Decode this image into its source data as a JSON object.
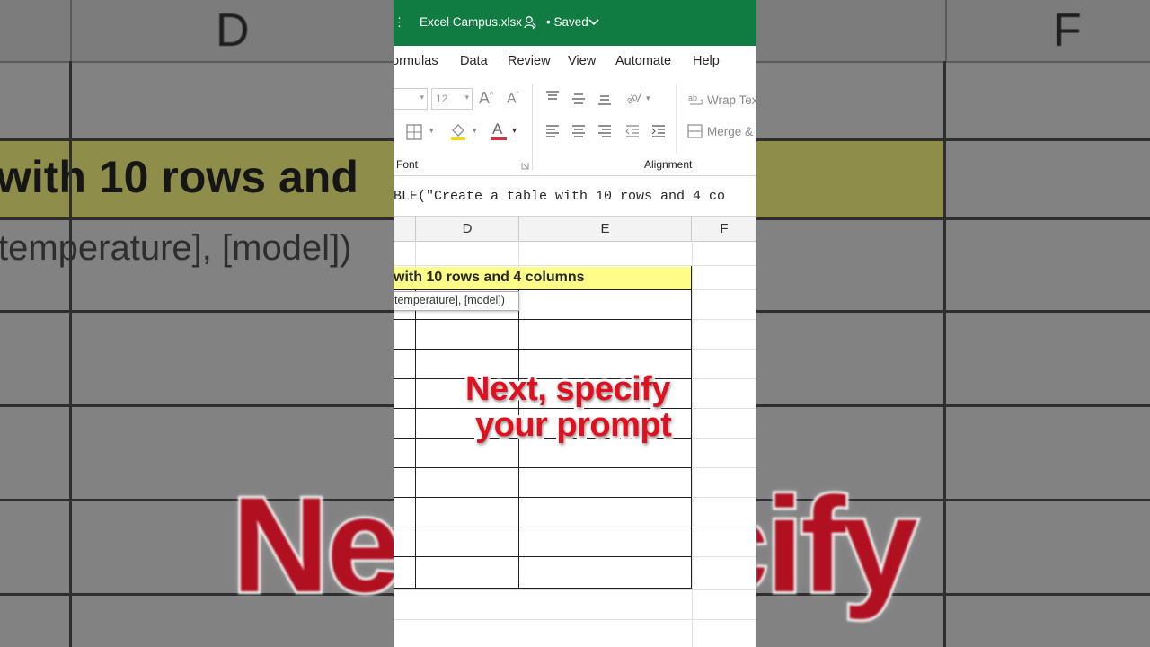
{
  "background": {
    "col_letters": [
      "D",
      "F"
    ],
    "heading_fragment": "with 10 rows and",
    "formula_fragment": "temperature], [model])",
    "caption_fragment_left": "Nex",
    "caption_fragment_right": "cify"
  },
  "titlebar": {
    "filename": "Excel Campus.xlsx",
    "save_status": "• Saved"
  },
  "menu": {
    "items": [
      "ormulas",
      "Data",
      "Review",
      "View",
      "Automate",
      "Help"
    ]
  },
  "ribbon": {
    "font_size_value": "12",
    "wrap_text_label": "Wrap Text",
    "merge_label": "Merge &",
    "group_font_label": "Font",
    "group_alignment_label": "Alignment",
    "icons": [
      "font-grow-icon",
      "font-shrink-icon",
      "borders-icon",
      "fill-color-icon",
      "font-color-icon",
      "align-top-icon",
      "align-middle-icon",
      "align-bottom-icon",
      "orientation-icon",
      "align-left-icon",
      "align-center-icon",
      "align-right-icon",
      "decrease-indent-icon",
      "increase-indent-icon",
      "wrap-text-icon",
      "merge-icon",
      "dialog-launcher-icon"
    ],
    "accent_font_color": "#d13438",
    "accent_fill_color": "#ffd700"
  },
  "formula_bar": {
    "text": "BLE(\"Create a table with 10 rows and 4 co"
  },
  "sheet": {
    "columns": [
      "D",
      "E",
      "F"
    ],
    "header_cell_text": "with 10 rows and 4 columns",
    "tooltip_text": "temperature], [model])",
    "header_fill_color": "#fdfd88"
  },
  "caption": {
    "line1": "Next, specify",
    "line2": "your prompt",
    "color": "#e0101e"
  },
  "brand": {
    "excel_green": "#107c41"
  }
}
